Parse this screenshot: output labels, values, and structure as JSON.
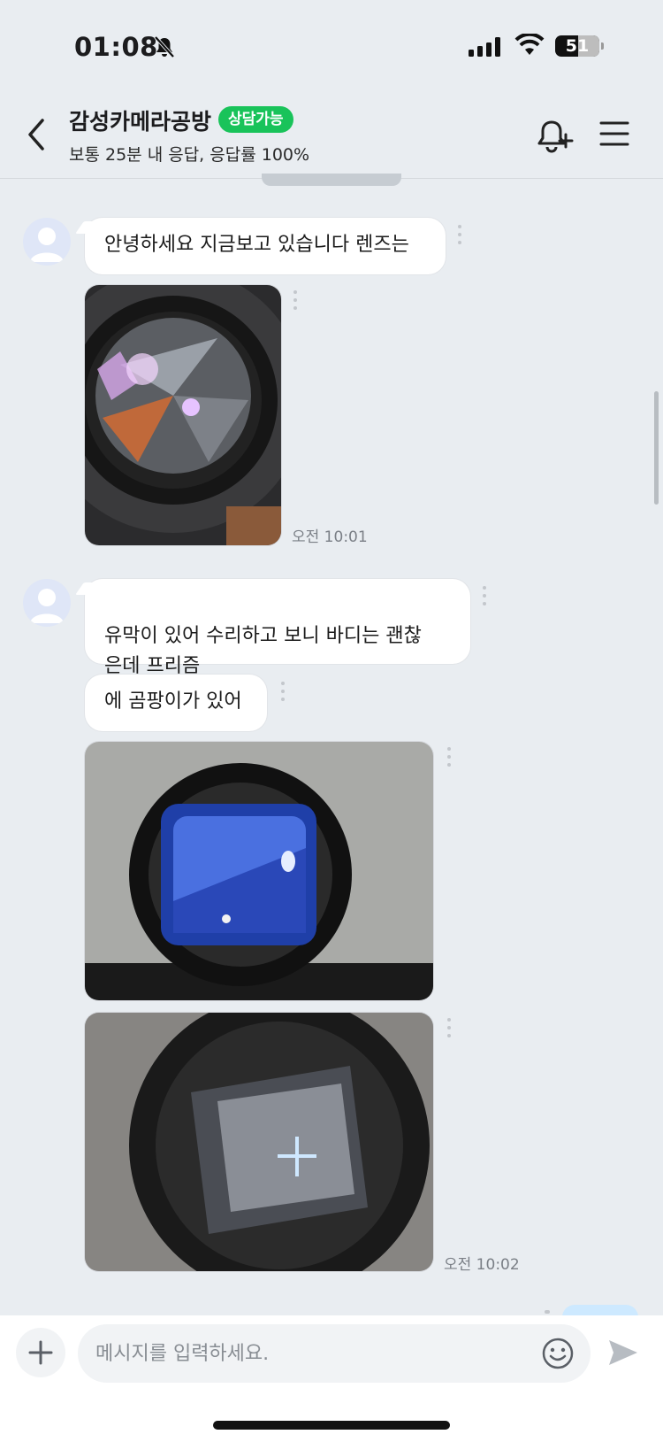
{
  "status_bar": {
    "time": "01:08",
    "battery": "51"
  },
  "header": {
    "title": "감성카메라공방",
    "badge": "상담가능",
    "subtitle": "보통 25분 내 응답, 응답률 100%"
  },
  "messages": [
    {
      "text": "안녕하세요 지금보고 있습니다 렌즈는"
    },
    {
      "timestamp": "오전 10:01"
    },
    {
      "text": "유막이 있어 수리하고 보니 바디는 괜찮\n은데 프리즘"
    },
    {
      "text": "에 곰팡이가 있어"
    },
    {
      "timestamp": "오전 10:02"
    }
  ],
  "input": {
    "placeholder": "메시지를 입력하세요."
  },
  "colors": {
    "badge": "#19c35a",
    "background": "#e9edf1"
  }
}
